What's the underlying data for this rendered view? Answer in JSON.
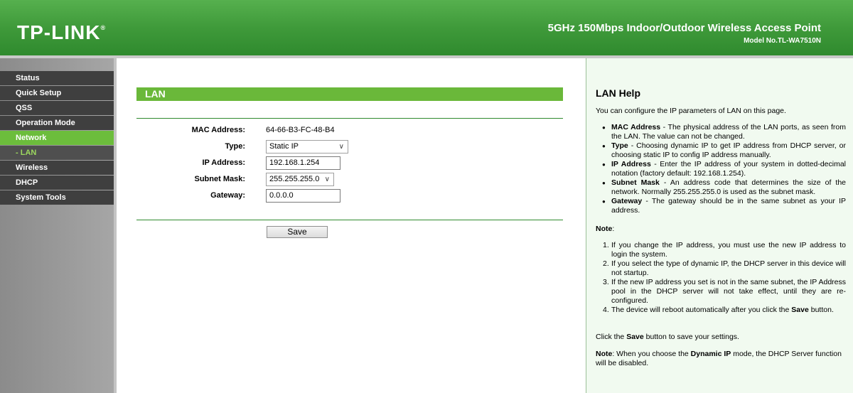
{
  "header": {
    "logo": "TP-LINK",
    "logo_mark": "®",
    "product_name": "5GHz 150Mbps Indoor/Outdoor Wireless Access Point",
    "model": "Model No.TL-WA7510N"
  },
  "sidebar": {
    "items": [
      {
        "label": "Status"
      },
      {
        "label": "Quick Setup"
      },
      {
        "label": "QSS"
      },
      {
        "label": "Operation Mode"
      },
      {
        "label": "Network"
      },
      {
        "label": "- LAN"
      },
      {
        "label": "Wireless"
      },
      {
        "label": "DHCP"
      },
      {
        "label": "System Tools"
      }
    ]
  },
  "main": {
    "section_title": "LAN",
    "mac_label": "MAC Address:",
    "mac_value": "64-66-B3-FC-48-B4",
    "type_label": "Type:",
    "type_value": "Static IP",
    "ip_label": "IP Address:",
    "ip_value": "192.168.1.254",
    "mask_label": "Subnet Mask:",
    "mask_value": "255.255.255.0",
    "gateway_label": "Gateway:",
    "gateway_value": "0.0.0.0",
    "save_label": "Save"
  },
  "help": {
    "title": "LAN Help",
    "intro": "You can configure the IP parameters of LAN on this page.",
    "bullets": [
      {
        "term": "MAC Address",
        "text": " - The physical address of the LAN ports, as seen from the LAN. The value can not be changed."
      },
      {
        "term": "Type",
        "text": " - Choosing dynamic IP to get IP address from DHCP server, or choosing static IP to config IP address manually."
      },
      {
        "term": "IP Address",
        "text": " - Enter the IP address of your system in dotted-decimal notation (factory default: 192.168.1.254)."
      },
      {
        "term": "Subnet Mask",
        "text": " - An address code that determines the size of the network. Normally 255.255.255.0 is used as the subnet mask."
      },
      {
        "term": "Gateway",
        "text": " - The gateway should be in the same subnet as your IP address."
      }
    ],
    "note_label": "Note",
    "note_colon": ":",
    "notes": [
      {
        "num": "1.",
        "text": "If you change the IP address, you must use the new IP address to login the system."
      },
      {
        "num": "2.",
        "text": "If you select the type of dynamic IP, the DHCP server in this device will not startup."
      },
      {
        "num": "3.",
        "text": "If the new IP address you set is not in the same subnet, the IP Address pool in the DHCP server will not take effect, until they are re-configured."
      },
      {
        "num": "4.",
        "text_before": "The device will reboot automatically after you click the ",
        "bold": "Save",
        "text_after": " button."
      }
    ],
    "click_before": "Click the ",
    "click_bold": "Save",
    "click_after": " button to save your settings.",
    "final_note_label": "Note",
    "final_before": ": When you choose the ",
    "final_bold": "Dynamic IP",
    "final_after": " mode, the DHCP Server function will be disabled."
  }
}
